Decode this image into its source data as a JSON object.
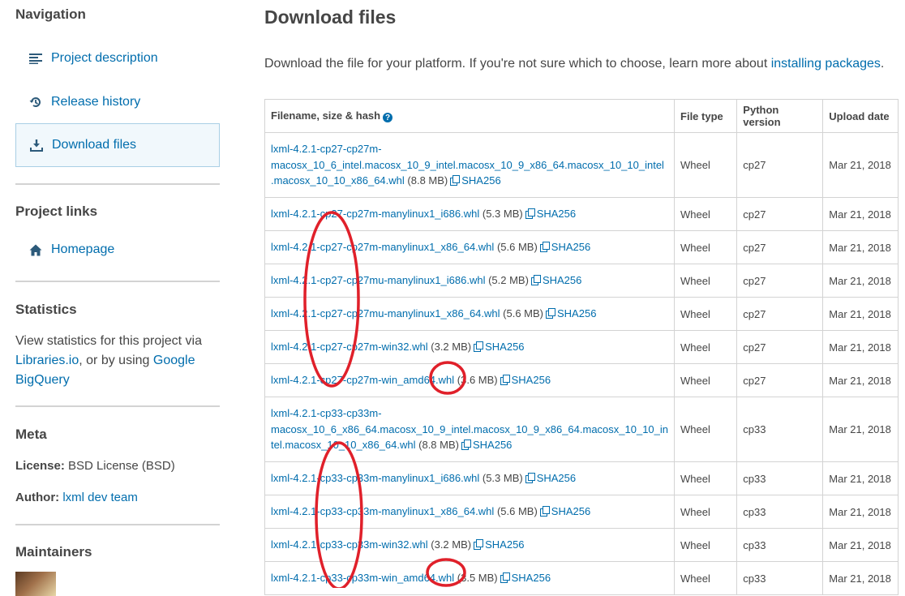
{
  "sidebar": {
    "navigation": {
      "heading": "Navigation",
      "items": [
        {
          "label": "Project description",
          "icon": "align-left-icon",
          "active": false
        },
        {
          "label": "Release history",
          "icon": "history-icon",
          "active": false
        },
        {
          "label": "Download files",
          "icon": "download-icon",
          "active": true
        }
      ]
    },
    "project_links": {
      "heading": "Project links",
      "items": [
        {
          "label": "Homepage",
          "icon": "home-icon"
        }
      ]
    },
    "statistics": {
      "heading": "Statistics",
      "text_before": "View statistics for this project via ",
      "link1": "Libraries.io",
      "text_mid": ", or by using ",
      "link2": "Google BigQuery"
    },
    "meta": {
      "heading": "Meta",
      "license_label": "License:",
      "license_value": "BSD License (BSD)",
      "author_label": "Author:",
      "author_value": "lxml dev team"
    },
    "maintainers": {
      "heading": "Maintainers"
    }
  },
  "main": {
    "title": "Download files",
    "intro_text": "Download the file for your platform. If you're not sure which to choose, learn more about ",
    "intro_link": "installing packages",
    "intro_end": ".",
    "table": {
      "headers": {
        "filename": "Filename, size & hash",
        "type": "File type",
        "python": "Python version",
        "date": "Upload date"
      },
      "hash_label": "SHA256",
      "rows": [
        {
          "lines": [
            "lxml-4.2.1-cp27-cp27m-",
            "macosx_10_6_intel.macosx_10_9_intel.macosx_10_9_x86_64.macosx_10_10_intel",
            ".macosx_10_10_x86_64.whl"
          ],
          "size": "(8.8 MB)",
          "type": "Wheel",
          "python": "cp27",
          "date": "Mar 21, 2018"
        },
        {
          "lines": [
            "lxml-4.2.1-cp27-cp27m-manylinux1_i686.whl"
          ],
          "size": "(5.3 MB)",
          "type": "Wheel",
          "python": "cp27",
          "date": "Mar 21, 2018"
        },
        {
          "lines": [
            "lxml-4.2.1-cp27-cp27m-manylinux1_x86_64.whl"
          ],
          "size": "(5.6 MB)",
          "type": "Wheel",
          "python": "cp27",
          "date": "Mar 21, 2018"
        },
        {
          "lines": [
            "lxml-4.2.1-cp27-cp27mu-manylinux1_i686.whl"
          ],
          "size": "(5.2 MB)",
          "type": "Wheel",
          "python": "cp27",
          "date": "Mar 21, 2018"
        },
        {
          "lines": [
            "lxml-4.2.1-cp27-cp27mu-manylinux1_x86_64.whl"
          ],
          "size": "(5.6 MB)",
          "type": "Wheel",
          "python": "cp27",
          "date": "Mar 21, 2018"
        },
        {
          "lines": [
            "lxml-4.2.1-cp27-cp27m-win32.whl"
          ],
          "size": "(3.2 MB)",
          "type": "Wheel",
          "python": "cp27",
          "date": "Mar 21, 2018"
        },
        {
          "lines": [
            "lxml-4.2.1-cp27-cp27m-win_amd64.whl"
          ],
          "size": "(3.6 MB)",
          "type": "Wheel",
          "python": "cp27",
          "date": "Mar 21, 2018"
        },
        {
          "lines": [
            "lxml-4.2.1-cp33-cp33m-",
            "macosx_10_6_x86_64.macosx_10_9_intel.macosx_10_9_x86_64.macosx_10_10_in",
            "tel.macosx_10_10_x86_64.whl"
          ],
          "size": "(8.8 MB)",
          "type": "Wheel",
          "python": "cp33",
          "date": "Mar 21, 2018"
        },
        {
          "lines": [
            "lxml-4.2.1-cp33-cp33m-manylinux1_i686.whl"
          ],
          "size": "(5.3 MB)",
          "type": "Wheel",
          "python": "cp33",
          "date": "Mar 21, 2018"
        },
        {
          "lines": [
            "lxml-4.2.1-cp33-cp33m-manylinux1_x86_64.whl"
          ],
          "size": "(5.6 MB)",
          "type": "Wheel",
          "python": "cp33",
          "date": "Mar 21, 2018"
        },
        {
          "lines": [
            "lxml-4.2.1-cp33-cp33m-win32.whl"
          ],
          "size": "(3.2 MB)",
          "type": "Wheel",
          "python": "cp33",
          "date": "Mar 21, 2018"
        },
        {
          "lines": [
            "lxml-4.2.1-cp33-cp33m-win_amd64.whl"
          ],
          "size": "(3.5 MB)",
          "type": "Wheel",
          "python": "cp33",
          "date": "Mar 21, 2018"
        }
      ]
    }
  },
  "annotations": {
    "color": "#e0202a"
  }
}
